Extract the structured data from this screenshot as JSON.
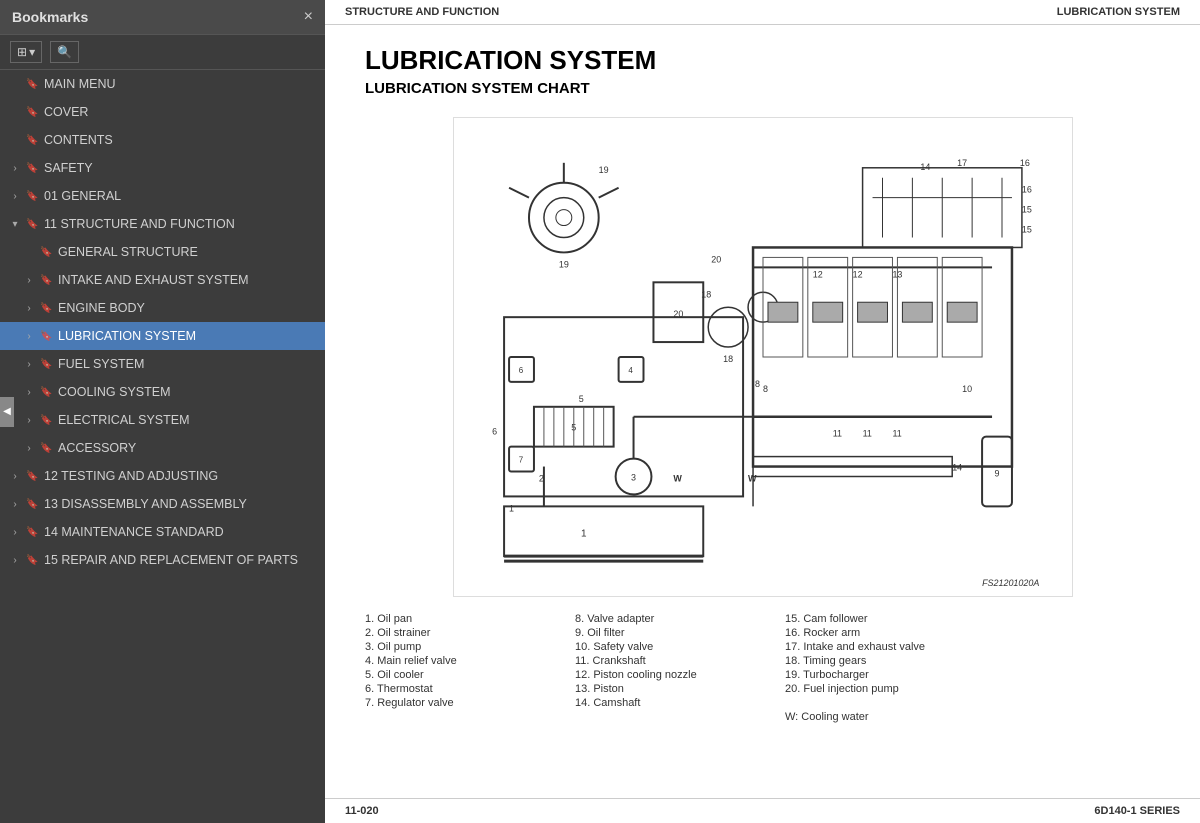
{
  "sidebar": {
    "title": "Bookmarks",
    "close_label": "×",
    "toolbar": {
      "view_btn": "☰▾",
      "search_btn": "🔍"
    },
    "items": [
      {
        "id": "main-menu",
        "label": "MAIN MENU",
        "level": 0,
        "expandable": false,
        "expanded": false,
        "active": false
      },
      {
        "id": "cover",
        "label": "COVER",
        "level": 0,
        "expandable": false,
        "expanded": false,
        "active": false
      },
      {
        "id": "contents",
        "label": "CONTENTS",
        "level": 0,
        "expandable": false,
        "expanded": false,
        "active": false
      },
      {
        "id": "safety",
        "label": "SAFETY",
        "level": 0,
        "expandable": true,
        "expanded": false,
        "active": false
      },
      {
        "id": "01-general",
        "label": "01 GENERAL",
        "level": 0,
        "expandable": true,
        "expanded": false,
        "active": false
      },
      {
        "id": "11-structure",
        "label": "11 STRUCTURE AND FUNCTION",
        "level": 0,
        "expandable": true,
        "expanded": true,
        "active": false
      },
      {
        "id": "general-structure",
        "label": "GENERAL STRUCTURE",
        "level": 1,
        "expandable": false,
        "expanded": false,
        "active": false
      },
      {
        "id": "intake-exhaust",
        "label": "INTAKE AND EXHAUST SYSTEM",
        "level": 1,
        "expandable": true,
        "expanded": false,
        "active": false
      },
      {
        "id": "engine-body",
        "label": "ENGINE BODY",
        "level": 1,
        "expandable": true,
        "expanded": false,
        "active": false
      },
      {
        "id": "lubrication",
        "label": "LUBRICATION SYSTEM",
        "level": 1,
        "expandable": true,
        "expanded": false,
        "active": true
      },
      {
        "id": "fuel-system",
        "label": "FUEL SYSTEM",
        "level": 1,
        "expandable": true,
        "expanded": false,
        "active": false
      },
      {
        "id": "cooling-system",
        "label": "COOLING SYSTEM",
        "level": 1,
        "expandable": true,
        "expanded": false,
        "active": false
      },
      {
        "id": "electrical",
        "label": "ELECTRICAL SYSTEM",
        "level": 1,
        "expandable": true,
        "expanded": false,
        "active": false
      },
      {
        "id": "accessory",
        "label": "ACCESSORY",
        "level": 1,
        "expandable": true,
        "expanded": false,
        "active": false
      },
      {
        "id": "12-testing",
        "label": "12 TESTING AND ADJUSTING",
        "level": 0,
        "expandable": true,
        "expanded": false,
        "active": false
      },
      {
        "id": "13-disassembly",
        "label": "13 DISASSEMBLY AND ASSEMBLY",
        "level": 0,
        "expandable": true,
        "expanded": false,
        "active": false
      },
      {
        "id": "14-maintenance",
        "label": "14 MAINTENANCE STANDARD",
        "level": 0,
        "expandable": true,
        "expanded": false,
        "active": false
      },
      {
        "id": "15-repair",
        "label": "15 REPAIR AND REPLACEMENT OF PARTS",
        "level": 0,
        "expandable": true,
        "expanded": false,
        "active": false
      }
    ]
  },
  "page": {
    "header_left": "STRUCTURE AND FUNCTION",
    "header_right": "LUBRICATION SYSTEM",
    "title": "LUBRICATION SYSTEM",
    "subtitle": "LUBRICATION SYSTEM CHART",
    "diagram_ref": "FS21201020A",
    "footer_left": "11-020",
    "footer_right": "6D140-1 SERIES",
    "legend": [
      {
        "col": 1,
        "items": [
          "1.  Oil pan",
          "2.  Oil strainer",
          "3.  Oil pump",
          "4.  Main relief valve",
          "5.  Oil cooler",
          "6.  Thermostat",
          "7.  Regulator valve"
        ]
      },
      {
        "col": 2,
        "items": [
          "8.  Valve adapter",
          "9.  Oil filter",
          "10. Safety valve",
          "11. Crankshaft",
          "12. Piston cooling nozzle",
          "13. Piston",
          "14. Camshaft"
        ]
      },
      {
        "col": 3,
        "items": [
          "15. Cam follower",
          "16. Rocker arm",
          "17. Intake and exhaust valve",
          "18. Timing gears",
          "19. Turbocharger",
          "20. Fuel injection pump",
          "",
          "W:  Cooling water"
        ]
      }
    ]
  }
}
